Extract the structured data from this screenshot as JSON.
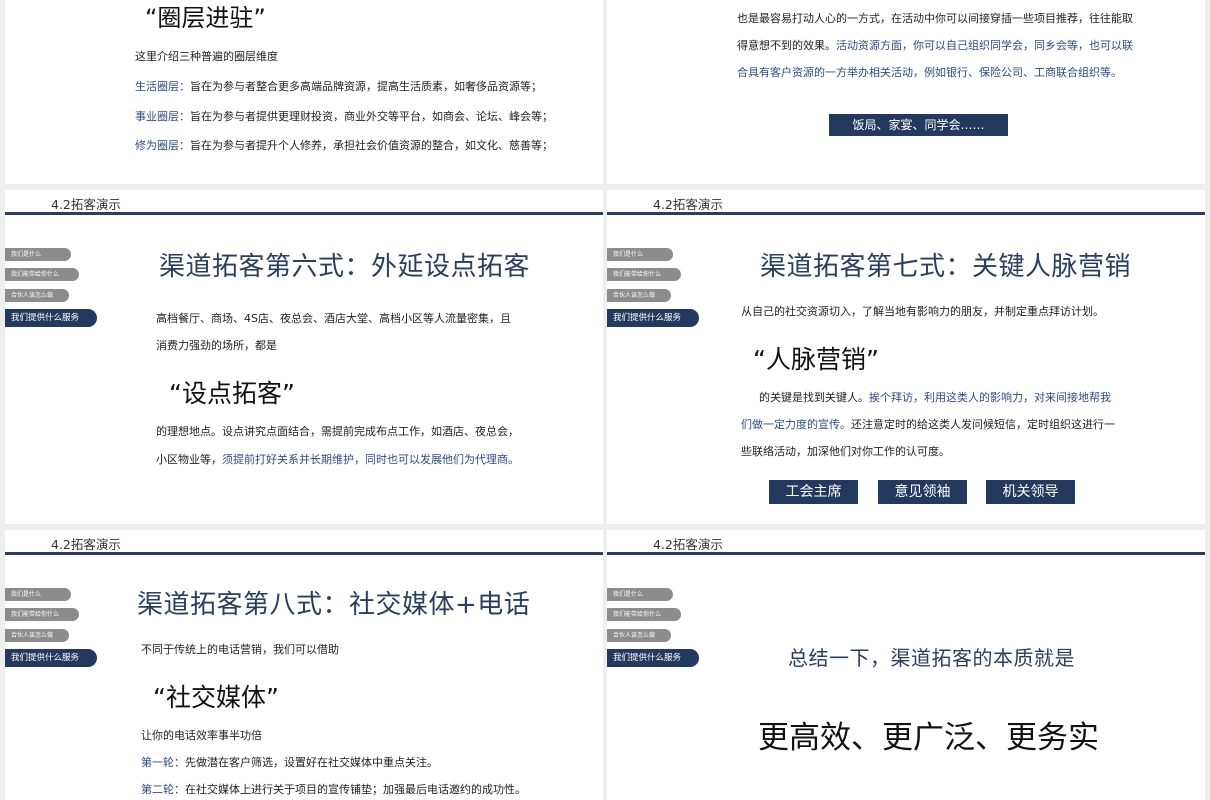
{
  "nav_items": [
    "我们是什么",
    "我们能带给你什么",
    "合伙人该怎么做",
    "我们提供什么服务"
  ],
  "section_title": "4.2拓客演示",
  "slide1": {
    "quote": "“圈层进驻”",
    "intro": "这里介绍三种普遍的圈层维度",
    "items": [
      {
        "label": "生活圈层：",
        "text": "旨在为参与者整合更多高端品牌资源，提高生活质素，如奢侈品资源等；"
      },
      {
        "label": "事业圈层：",
        "text": "旨在为参与者提供更理财投资，商业外交等平台，如商会、论坛、峰会等；"
      },
      {
        "label": "修为圈层：",
        "text": "旨在为参与者提升个人修养，承担社会价值资源的整合，如文化、慈善等；"
      }
    ]
  },
  "slide2": {
    "line1": "也是最容易打动人心的一方式，在活动中你可以间接穿插一些项目推荐，往往能取",
    "line2a": "得意想不到的效果。",
    "line2b": "活动资源方面，你可以自己组织同学会，同乡会等，也可以联",
    "line3": "合具有客户资源的一方举办相关活动，例如银行、保险公司、工商联合组织等。",
    "button": "饭局、家宴、同学会……"
  },
  "slide3": {
    "title": "渠道拓客第六式：外延设点拓客",
    "p1": "高档餐厅、商场、4S店、夜总会、酒店大堂、高档小区等人流量密集，且",
    "p2": "消费力强劲的场所，都是",
    "quote": "“设点拓客”",
    "p3": "的理想地点。设点讲究点面结合，需提前完成布点工作，如酒店、夜总会，",
    "p4a": "小区物业等，",
    "p4b": "须提前打好关系并长期维护，同时也可以发展他们为代理商。"
  },
  "slide4": {
    "title": "渠道拓客第七式：关键人脉营销",
    "p1": "从自己的社交资源切入，了解当地有影响力的朋友，并制定重点拜访计划。",
    "quote": "“人脉营销”",
    "p2a": "的关键是找到关键人。",
    "p2b": "挨个拜访，利用这类人的影响力，对来间接地帮我",
    "p3a": "们做一定力度的宣传。",
    "p3b": "还注意定时的给这类人发问候短信，定时组织这进行一",
    "p4": "些联络活动，加深他们对你工作的认可度。",
    "tags": [
      "工会主席",
      "意见领袖",
      "机关领导"
    ]
  },
  "slide5": {
    "title": "渠道拓客第八式：社交媒体+电话",
    "p1": "不同于传统上的电话营销，我们可以借助",
    "quote": "“社交媒体”",
    "p2": "让你的电话效率事半功倍",
    "r1label": "第一轮：",
    "r1text": "先做潜在客户筛选，设置好在社交媒体中重点关注。",
    "r2label": "第二轮：",
    "r2text": "在社交媒体上进行关于项目的宣传铺垫；加强最后电话邀约的成功性。"
  },
  "slide6": {
    "lead": "总结一下，渠道拓客的本质就是",
    "big": "更高效、更广泛、更务实"
  }
}
